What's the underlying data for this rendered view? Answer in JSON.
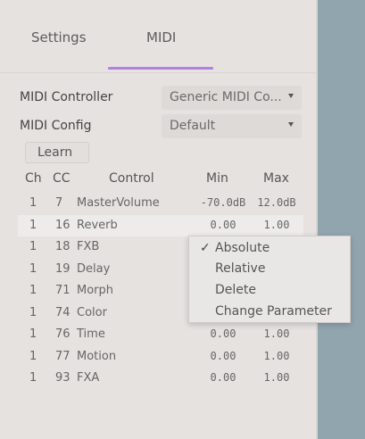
{
  "tabs": [
    {
      "label": "Settings",
      "active": false
    },
    {
      "label": "MIDI",
      "active": true
    }
  ],
  "accent_color": "#b57fe6",
  "fields": {
    "controller": {
      "label": "MIDI Controller",
      "value": "Generic MIDI Co..."
    },
    "config": {
      "label": "MIDI Config",
      "value": "Default"
    }
  },
  "learn_label": "Learn",
  "table": {
    "headers": {
      "ch": "Ch",
      "cc": "CC",
      "control": "Control",
      "min": "Min",
      "max": "Max"
    },
    "rows": [
      {
        "ch": "1",
        "cc": "7",
        "control": "MasterVolume",
        "min": "-70.0dB",
        "max": "12.0dB"
      },
      {
        "ch": "1",
        "cc": "16",
        "control": "Reverb",
        "min": "0.00",
        "max": "1.00"
      },
      {
        "ch": "1",
        "cc": "18",
        "control": "FXB",
        "min": "",
        "max": ""
      },
      {
        "ch": "1",
        "cc": "19",
        "control": "Delay",
        "min": "",
        "max": ""
      },
      {
        "ch": "1",
        "cc": "71",
        "control": "Morph",
        "min": "",
        "max": ""
      },
      {
        "ch": "1",
        "cc": "74",
        "control": "Color",
        "min": "",
        "max": ""
      },
      {
        "ch": "1",
        "cc": "76",
        "control": "Time",
        "min": "0.00",
        "max": "1.00"
      },
      {
        "ch": "1",
        "cc": "77",
        "control": "Motion",
        "min": "0.00",
        "max": "1.00"
      },
      {
        "ch": "1",
        "cc": "93",
        "control": "FXA",
        "min": "0.00",
        "max": "1.00"
      }
    ]
  },
  "context_menu": {
    "items": [
      {
        "label": "Absolute",
        "checked": true,
        "check": "✓"
      },
      {
        "label": "Relative",
        "checked": false
      },
      {
        "label": "Delete",
        "checked": false
      },
      {
        "label": "Change Parameter",
        "checked": false
      }
    ]
  }
}
